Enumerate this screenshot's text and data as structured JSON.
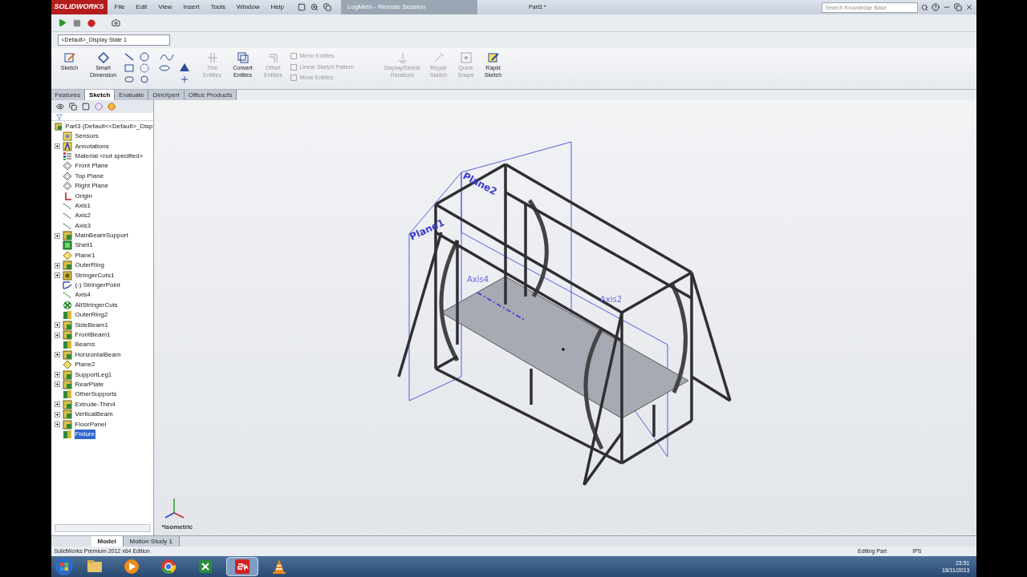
{
  "title_bar": {
    "app": "SOLIDWORKS",
    "menu": [
      "File",
      "Edit",
      "View",
      "Insert",
      "Tools",
      "Window",
      "Help"
    ],
    "remote_tab": "LogMeIn - Remote Session",
    "document": "Part3 *",
    "search": {
      "placeholder": "Search Knowledge Base"
    }
  },
  "display_state": "<Default>_Display State 1",
  "command_manager": [
    {
      "label": "Sketch",
      "kind": "sketch",
      "disabled": false
    },
    {
      "label": "Smart Dimension",
      "kind": "dimension",
      "disabled": false
    },
    {
      "label": "Trim Entities",
      "kind": "trim",
      "disabled": true
    },
    {
      "label": "Convert Entities",
      "kind": "convert",
      "disabled": false
    },
    {
      "label": "Offset Entities",
      "kind": "offset",
      "disabled": true
    },
    {
      "label": "Display/Delete Relations",
      "kind": "relations",
      "disabled": true
    },
    {
      "label": "Repair Sketch",
      "kind": "repair",
      "disabled": true
    },
    {
      "label": "Quick Snaps",
      "kind": "snaps",
      "disabled": true
    },
    {
      "label": "Rapid Sketch",
      "kind": "rapid",
      "disabled": false
    }
  ],
  "entity_tools": [
    {
      "label": "Mirror Entities",
      "disabled": true
    },
    {
      "label": "Linear Sketch Pattern",
      "disabled": true
    },
    {
      "label": "Move Entities",
      "disabled": true
    }
  ],
  "tabs": [
    {
      "label": "Features",
      "selected": false
    },
    {
      "label": "Sketch",
      "selected": true
    },
    {
      "label": "Evaluate",
      "selected": false
    },
    {
      "label": "DimXpert",
      "selected": false
    },
    {
      "label": "Office Products",
      "selected": false
    }
  ],
  "feature_tree": {
    "root": "Part3  (Default<<Default>_Disp",
    "items": [
      {
        "label": "Sensors",
        "kind": "sensor",
        "expandable": false,
        "selected": false
      },
      {
        "label": "Annotations",
        "kind": "annotation",
        "expandable": true,
        "selected": false
      },
      {
        "label": "Material <not specified>",
        "kind": "material",
        "expandable": false,
        "selected": false
      },
      {
        "label": "Front Plane",
        "kind": "plane",
        "expandable": false,
        "selected": false
      },
      {
        "label": "Top Plane",
        "kind": "plane",
        "expandable": false,
        "selected": false
      },
      {
        "label": "Right Plane",
        "kind": "plane",
        "expandable": false,
        "selected": false
      },
      {
        "label": "Origin",
        "kind": "origin",
        "expandable": false,
        "selected": false
      },
      {
        "label": "Axis1",
        "kind": "axis",
        "expandable": false,
        "selected": false
      },
      {
        "label": "Axis2",
        "kind": "axis",
        "expandable": false,
        "selected": false
      },
      {
        "label": "Axis3",
        "kind": "axis",
        "expandable": false,
        "selected": false
      },
      {
        "label": "MainBeamSupport",
        "kind": "feature",
        "expandable": true,
        "selected": false
      },
      {
        "label": "Shell1",
        "kind": "shell",
        "expandable": false,
        "selected": false
      },
      {
        "label": "Plane1",
        "kind": "refplane",
        "expandable": false,
        "selected": false
      },
      {
        "label": "OuterRing",
        "kind": "feature",
        "expandable": true,
        "selected": false
      },
      {
        "label": "StringerCuts1",
        "kind": "cut",
        "expandable": true,
        "selected": false
      },
      {
        "label": "(-) StringerPoint",
        "kind": "sketch",
        "expandable": false,
        "selected": false
      },
      {
        "label": "Axis4",
        "kind": "axis",
        "expandable": false,
        "selected": false
      },
      {
        "label": "AllStringerCuts",
        "kind": "pattern",
        "expandable": false,
        "selected": false
      },
      {
        "label": "OuterRing2",
        "kind": "weldment",
        "expandable": false,
        "selected": false
      },
      {
        "label": "SideBeam1",
        "kind": "feature",
        "expandable": true,
        "selected": false
      },
      {
        "label": "FrontBeam1",
        "kind": "feature",
        "expandable": true,
        "selected": false
      },
      {
        "label": "Beams",
        "kind": "weldment",
        "expandable": false,
        "selected": false
      },
      {
        "label": "HorizontalBeam",
        "kind": "feature",
        "expandable": true,
        "selected": false
      },
      {
        "label": "Plane2",
        "kind": "refplane",
        "expandable": false,
        "selected": false
      },
      {
        "label": "SupportLeg1",
        "kind": "feature",
        "expandable": true,
        "selected": false
      },
      {
        "label": "RearPlate",
        "kind": "feature",
        "expandable": true,
        "selected": false
      },
      {
        "label": "OtherSupports",
        "kind": "weldment",
        "expandable": false,
        "selected": false
      },
      {
        "label": "Extrude-Thin4",
        "kind": "feature",
        "expandable": true,
        "selected": false
      },
      {
        "label": "VerticalBeam",
        "kind": "feature",
        "expandable": true,
        "selected": false
      },
      {
        "label": "FloorPanel",
        "kind": "feature",
        "expandable": true,
        "selected": false
      },
      {
        "label": "Fixture",
        "kind": "weldment",
        "expandable": false,
        "selected": true
      }
    ]
  },
  "viewport": {
    "labels": [
      {
        "text": "Plane1",
        "kind": "plane"
      },
      {
        "text": "Plane2",
        "kind": "plane"
      },
      {
        "text": "Axis4",
        "kind": "axis"
      },
      {
        "text": "Axis2",
        "kind": "axis"
      }
    ],
    "view_name": "*Isometric"
  },
  "bottom_tabs": [
    {
      "label": "Model",
      "selected": true
    },
    {
      "label": "Motion Study 1",
      "selected": false
    }
  ],
  "status_bar": {
    "edition": "SolidWorks Premium 2012 x64 Edition",
    "mode": "Editing Part",
    "units": "IPS"
  },
  "taskbar": {
    "apps": [
      {
        "kind": "explorer",
        "active": false
      },
      {
        "kind": "media",
        "active": false
      },
      {
        "kind": "chrome",
        "active": false
      },
      {
        "kind": "excel",
        "active": false
      },
      {
        "kind": "solidworks",
        "active": true
      },
      {
        "kind": "vlc",
        "active": false
      }
    ],
    "time": "23:51",
    "date": "18/11/2013"
  }
}
